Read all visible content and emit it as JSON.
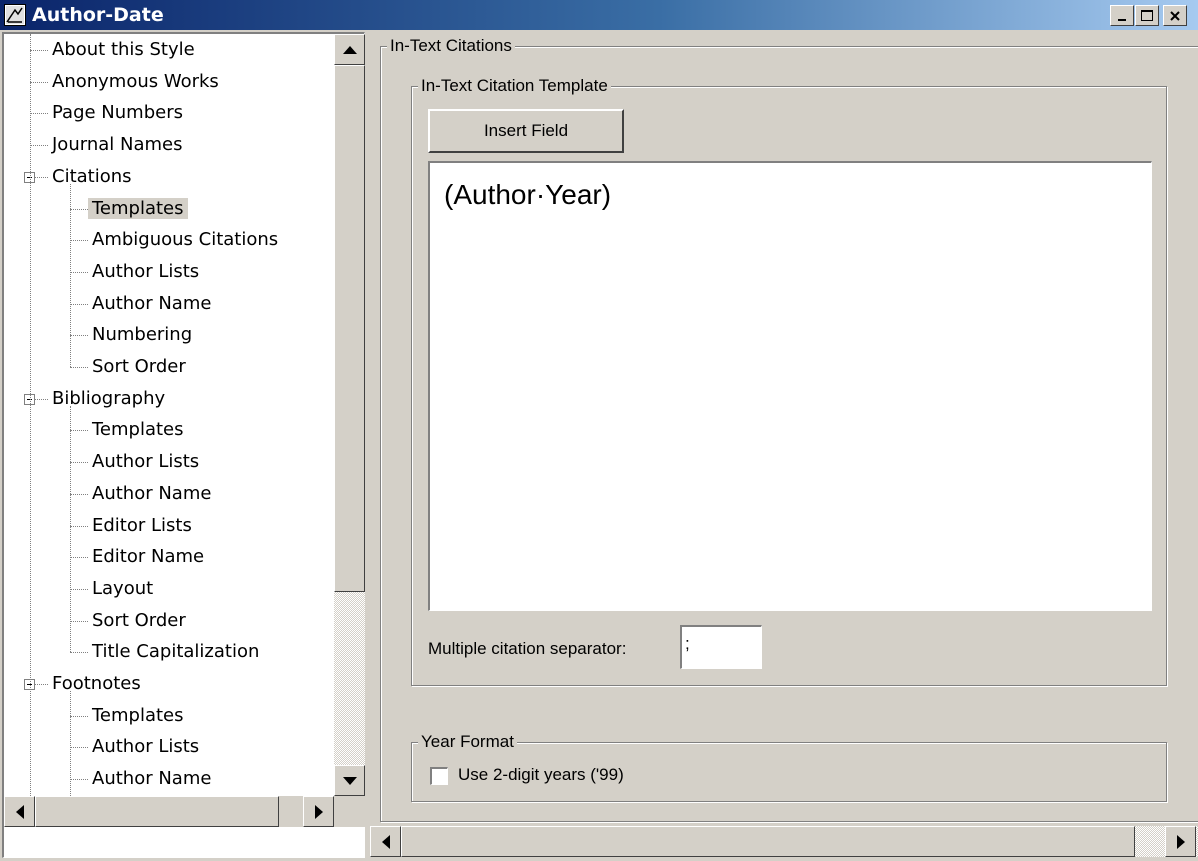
{
  "window": {
    "title": "Author-Date",
    "icon": "style-icon",
    "controls": {
      "minimize": "minimize-icon",
      "maximize": "maximize-icon",
      "close": "close-icon"
    }
  },
  "tree": {
    "items": [
      {
        "label": "About this Style",
        "level": 0
      },
      {
        "label": "Anonymous Works",
        "level": 0
      },
      {
        "label": "Page Numbers",
        "level": 0
      },
      {
        "label": "Journal Names",
        "level": 0
      },
      {
        "label": "Citations",
        "level": 0,
        "expanded": true
      },
      {
        "label": "Templates",
        "level": 1,
        "selected": true
      },
      {
        "label": "Ambiguous Citations",
        "level": 1
      },
      {
        "label": "Author Lists",
        "level": 1
      },
      {
        "label": "Author Name",
        "level": 1
      },
      {
        "label": "Numbering",
        "level": 1
      },
      {
        "label": "Sort Order",
        "level": 1
      },
      {
        "label": "Bibliography",
        "level": 0,
        "expanded": true
      },
      {
        "label": "Templates",
        "level": 1
      },
      {
        "label": "Author Lists",
        "level": 1
      },
      {
        "label": "Author Name",
        "level": 1
      },
      {
        "label": "Editor Lists",
        "level": 1
      },
      {
        "label": "Editor Name",
        "level": 1
      },
      {
        "label": "Layout",
        "level": 1
      },
      {
        "label": "Sort Order",
        "level": 1
      },
      {
        "label": "Title Capitalization",
        "level": 1
      },
      {
        "label": "Footnotes",
        "level": 0,
        "expanded": true
      },
      {
        "label": "Templates",
        "level": 1
      },
      {
        "label": "Author Lists",
        "level": 1
      },
      {
        "label": "Author Name",
        "level": 1
      }
    ]
  },
  "in_text": {
    "group_label": "In-Text Citations",
    "template_group_label": "In-Text Citation Template",
    "insert_field_label": "Insert Field",
    "template_value": "(Author·Year)",
    "separator_label": "Multiple citation separator:",
    "separator_value": ";"
  },
  "year_format": {
    "group_label": "Year Format",
    "checkbox_label": "Use 2-digit years ('99)",
    "checked": false
  }
}
